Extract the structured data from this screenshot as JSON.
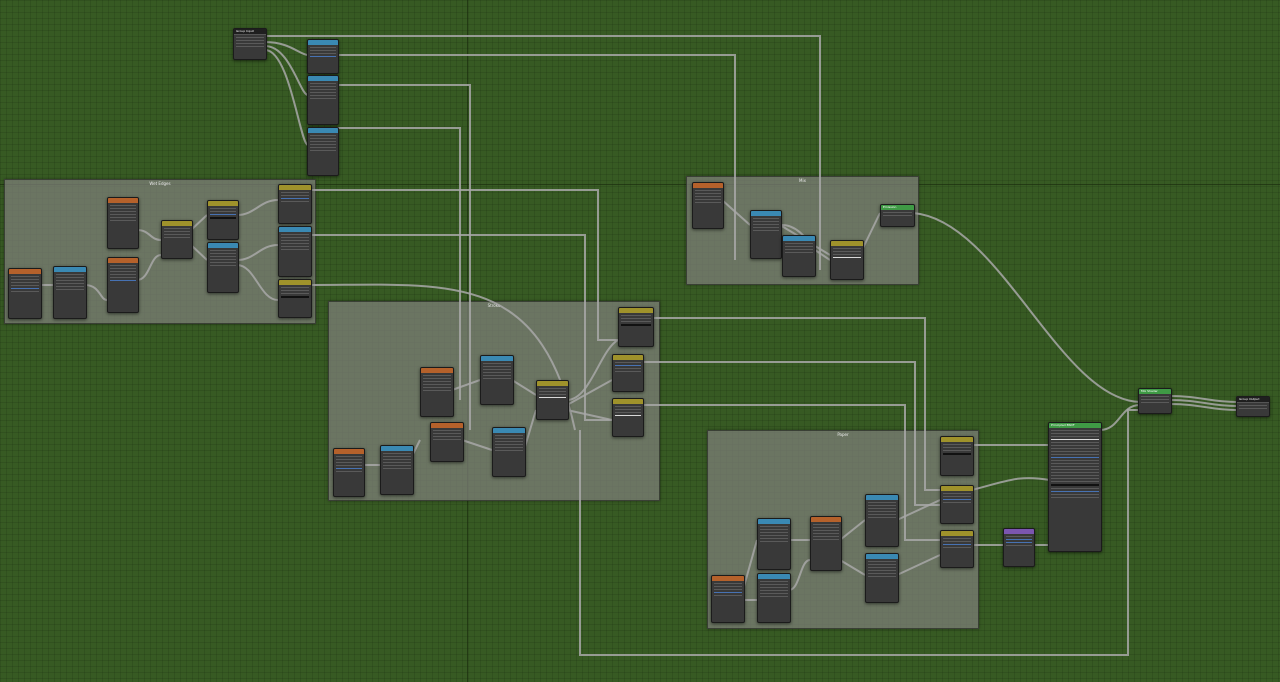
{
  "editor": {
    "app": "Blender",
    "view": "Shader Editor — node graph"
  },
  "frames": [
    {
      "id": "frame-a",
      "label": "Wet Edges"
    },
    {
      "id": "frame-b",
      "label": "Stroke"
    },
    {
      "id": "frame-c",
      "label": "Paper"
    },
    {
      "id": "frame-d",
      "label": "Mix"
    }
  ],
  "nodes": {
    "group_input": {
      "title": "Group Input"
    },
    "group_output": {
      "title": "Group Output"
    },
    "shader_mix": {
      "title": "Mix Shader"
    },
    "principled": {
      "title": "Principled BSDF"
    },
    "emission": {
      "title": "Emission"
    }
  },
  "colors": {
    "grid": "#375a23",
    "frame": "#80807c",
    "node_body": "#393939",
    "texture_header": "#b5612b",
    "vector_header": "#3a89b3",
    "converter_header": "#9f922b",
    "shader_header": "#3f9a45",
    "wire": "#a8a8a8"
  }
}
